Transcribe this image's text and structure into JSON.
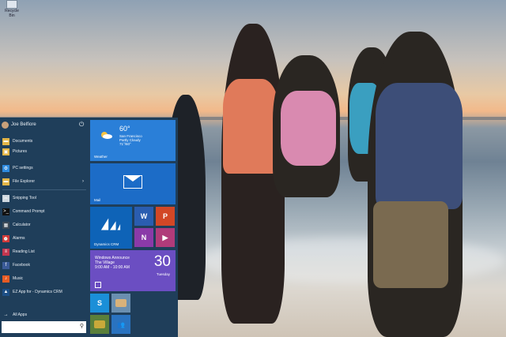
{
  "desktop": {
    "recycle_label": "Recycle Bin"
  },
  "start_menu": {
    "user_name": "Joe Belfiore",
    "items": [
      {
        "label": "Documents",
        "icon": "folder-icon",
        "color": "#e3b548"
      },
      {
        "label": "Pictures",
        "icon": "pictures-icon",
        "color": "#e3b548"
      },
      {
        "label": "PC settings",
        "icon": "gear-icon",
        "color": "#2e8be0"
      },
      {
        "label": "File Explorer",
        "icon": "folder-icon",
        "color": "#e3b548"
      },
      {
        "label": "Snipping Tool",
        "icon": "scissors-icon",
        "color": "#cfd8e0"
      },
      {
        "label": "Command Prompt",
        "icon": "terminal-icon",
        "color": "#111111"
      },
      {
        "label": "Calculator",
        "icon": "calculator-icon",
        "color": "#3b4a58"
      },
      {
        "label": "Alarms",
        "icon": "alarm-icon",
        "color": "#d23a3a"
      },
      {
        "label": "Reading List",
        "icon": "reading-list-icon",
        "color": "#c2364f"
      },
      {
        "label": "Facebook",
        "icon": "facebook-icon",
        "color": "#3b5b98"
      },
      {
        "label": "Music",
        "icon": "music-icon",
        "color": "#e85b24"
      },
      {
        "label": "EZ App for - Dynamics CRM",
        "icon": "crm-icon",
        "color": "#1d4f86"
      }
    ],
    "all_apps_label": "All Apps"
  },
  "tiles": {
    "weather": {
      "temp": "60°",
      "city": "San Francisco",
      "condition": "Partly Cloudy",
      "range": "71°/60°",
      "name": "Weather"
    },
    "mail": {
      "name": "Mail"
    },
    "crm": {
      "name": "Dynamics CRM"
    },
    "small": [
      {
        "letter": "W",
        "color": "#2a5db0",
        "icon": "word-icon"
      },
      {
        "letter": "P",
        "color": "#d24726",
        "icon": "powerpoint-icon"
      },
      {
        "letter": "N",
        "color": "#8a3aa8",
        "icon": "onenote-icon"
      },
      {
        "letter": "▶",
        "color": "#b03b7a",
        "icon": "video-icon"
      }
    ],
    "calendar": {
      "line1": "Windows Announce",
      "line2": "The Village",
      "line3": "9:00 AM - 10:00 AM",
      "day_number": "30",
      "day_name": "Tuesday"
    },
    "bottom": [
      {
        "letter": "S",
        "color": "#1b8fd8",
        "icon": "skype-icon"
      },
      {
        "letter": "",
        "color": "#6a8fb0",
        "icon": "photo-icon"
      },
      {
        "letter": "",
        "color": "#5a7f3a",
        "icon": "game-icon"
      },
      {
        "letter": "",
        "color": "#2a73c0",
        "icon": "people-icon"
      }
    ]
  }
}
